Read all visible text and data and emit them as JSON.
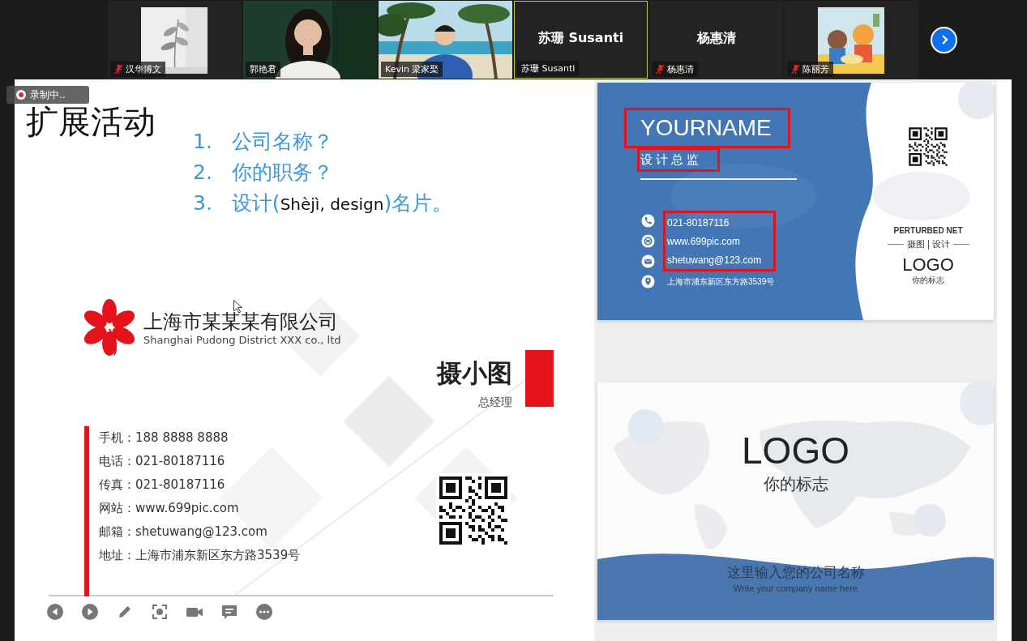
{
  "meeting": {
    "tiles": [
      {
        "name": "汉华博文",
        "kind": "picture",
        "muted": true,
        "selected": false
      },
      {
        "name": "郭艳君",
        "kind": "video",
        "muted": false,
        "selected": false
      },
      {
        "name": "Kevin 梁家棸",
        "kind": "video",
        "muted": false,
        "selected": false
      },
      {
        "name": "苏珊 Susanti",
        "kind": "name",
        "display_name": "苏珊 Susanti",
        "muted": false,
        "selected": true
      },
      {
        "name": "杨惠清",
        "kind": "name",
        "display_name": "杨惠清",
        "muted": true,
        "selected": false
      },
      {
        "name": "陈丽芳",
        "kind": "picture",
        "muted": true,
        "selected": false
      }
    ],
    "recording": "录制中.."
  },
  "slide": {
    "title": "扩展活动",
    "questions": [
      {
        "number": "1.",
        "parts": [
          {
            "text": "公司名称？",
            "kind": "plain"
          }
        ]
      },
      {
        "number": "2.",
        "parts": [
          {
            "text": "你的职务？",
            "kind": "plain"
          }
        ]
      },
      {
        "number": "3.",
        "parts": [
          {
            "text": "设计(",
            "kind": "plain"
          },
          {
            "text": "Shèjì, design",
            "kind": "gloss"
          },
          {
            "text": ")名片。",
            "kind": "plain"
          }
        ]
      }
    ],
    "sample_card": {
      "company": "上海市某某某有限公司",
      "company_en": "Shanghai Pudong District XXX co., ltd",
      "name": "摄小图",
      "position": "总经理",
      "contacts": [
        "手机：188 8888 8888",
        "电话：021-80187116",
        "传真：021-80187116",
        "网站：www.699pic.com",
        "邮箱：shetuwang@123.com",
        "地址：上海市浦东新区东方路3539号"
      ]
    },
    "tools": [
      {
        "kind": "previous"
      },
      {
        "kind": "next"
      },
      {
        "kind": "pen"
      },
      {
        "kind": "focus"
      },
      {
        "kind": "camera"
      },
      {
        "kind": "chat"
      },
      {
        "kind": "more"
      }
    ],
    "card_front": {
      "name": {
        "text": "YOURNAME",
        "highlighted": true
      },
      "title": {
        "text": "设计总监",
        "highlighted": true
      },
      "contacts": [
        {
          "kind": "phone",
          "text": "021-80187116",
          "highlighted": true
        },
        {
          "kind": "web",
          "text": "www.699pic.com",
          "highlighted": true
        },
        {
          "kind": "mail",
          "text": "shetuwang@123.com",
          "highlighted": true
        },
        {
          "kind": "location",
          "text": "上海市浦东新区东方路3539号",
          "highlighted": false
        }
      ],
      "brand": "PERTURBED NET",
      "brand_left": "摄图",
      "brand_right": "设计",
      "logo": "LOGO",
      "logo_caption": "你的标志"
    },
    "card_back": {
      "logo": "LOGO",
      "logo_caption": "你的标志",
      "company": "这里输入您的公司名称",
      "company_en": "Write your company name here"
    }
  }
}
